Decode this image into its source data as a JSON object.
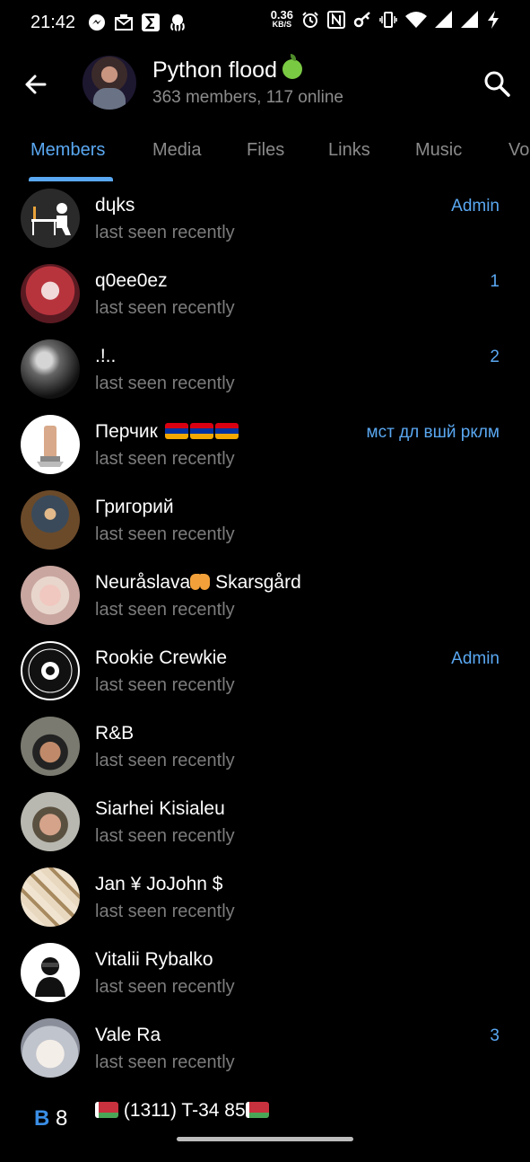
{
  "status_bar": {
    "time": "21:42",
    "speed_value": "0.36",
    "speed_unit": "KB/S",
    "left_icons": [
      "messenger-icon",
      "mail-icon",
      "sigma-icon",
      "octopus-icon"
    ],
    "right_icons": [
      "alarm-icon",
      "nfc-icon",
      "key-icon",
      "vibrate-icon",
      "wifi-icon",
      "signal-icon",
      "signal-icon-2",
      "charging-icon"
    ]
  },
  "header": {
    "title": "Python flood",
    "subtitle": "363 members, 117 online"
  },
  "tabs": [
    {
      "label": "Members",
      "active": true
    },
    {
      "label": "Media",
      "active": false
    },
    {
      "label": "Files",
      "active": false
    },
    {
      "label": "Links",
      "active": false
    },
    {
      "label": "Music",
      "active": false
    },
    {
      "label": "Vo",
      "active": false
    }
  ],
  "members": [
    {
      "name": "dɥks",
      "status": "last seen recently",
      "badge": "Admin"
    },
    {
      "name": "q0ee0ez",
      "status": "last seen recently",
      "badge": "1"
    },
    {
      "name": ".!..",
      "status": "last seen recently",
      "badge": "2"
    },
    {
      "name": "Перчик",
      "status": "last seen recently",
      "badge": "мст дл вшй рклм"
    },
    {
      "name": "Григорий",
      "status": "last seen recently",
      "badge": ""
    },
    {
      "name_a": "Neuråslava",
      "name_b": " Skarsgård",
      "status": "last seen recently",
      "badge": ""
    },
    {
      "name": "Rookie Crewkie",
      "status": "last seen recently",
      "badge": "Admin"
    },
    {
      "name": "R&B",
      "status": "last seen recently",
      "badge": ""
    },
    {
      "name": "Siarhei Kisialeu",
      "status": "last seen recently",
      "badge": ""
    },
    {
      "name": "Jan ¥ JoJohn $",
      "status": "last seen recently",
      "badge": ""
    },
    {
      "name": "Vitalii Rybalko",
      "status": "last seen recently",
      "badge": ""
    },
    {
      "name": "Vale Ra",
      "status": "last seen recently",
      "badge": "3"
    },
    {
      "name": " (1311) T-34 85",
      "status": "",
      "badge": "",
      "avatar_text_a": "B",
      "avatar_text_b": "8"
    }
  ],
  "colors": {
    "accent": "#5aa8f2",
    "background": "#000000",
    "secondary_text": "#7c7c7c"
  }
}
